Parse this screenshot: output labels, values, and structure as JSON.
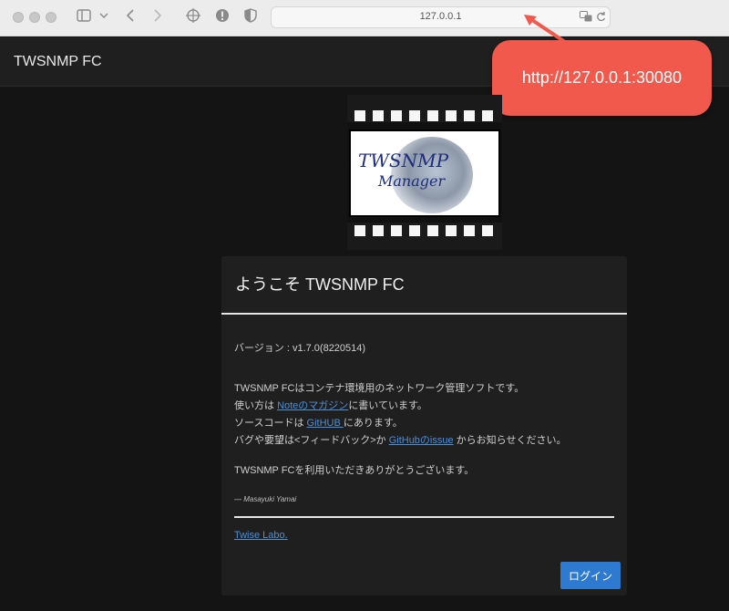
{
  "browser": {
    "url": "127.0.0.1"
  },
  "app": {
    "title": "TWSNMP FC"
  },
  "annotation": {
    "text": "http://127.0.0.1:30080",
    "color": "#f1594d"
  },
  "logo": {
    "line1": "TWSNMP",
    "line2": "Manager"
  },
  "card": {
    "title": "ようこそ TWSNMP FC",
    "version": "バージョン : v1.7.0(8220514)",
    "p1": "TWSNMP FCはコンテナ環境用のネットワーク管理ソフトです。",
    "p2_pre": "使い方は ",
    "p2_link": "Noteのマガジン",
    "p2_post": "に書いています。",
    "p3_pre": "ソースコードは ",
    "p3_link": "GitHUB ",
    "p3_post": "にあります。",
    "p4_pre": "バグや要望は<フィードバック>か ",
    "p4_link": "GitHubのissue",
    "p4_post": " からお知らせください。",
    "thanks": "TWSNMP FCを利用いただきありがとうございます。",
    "signature": "— Masayuki Yamai",
    "footer_link": "Twise Labo.",
    "login_label": "ログイン",
    "accent": "#2f7ad1",
    "link_color": "#4d8fd8"
  }
}
